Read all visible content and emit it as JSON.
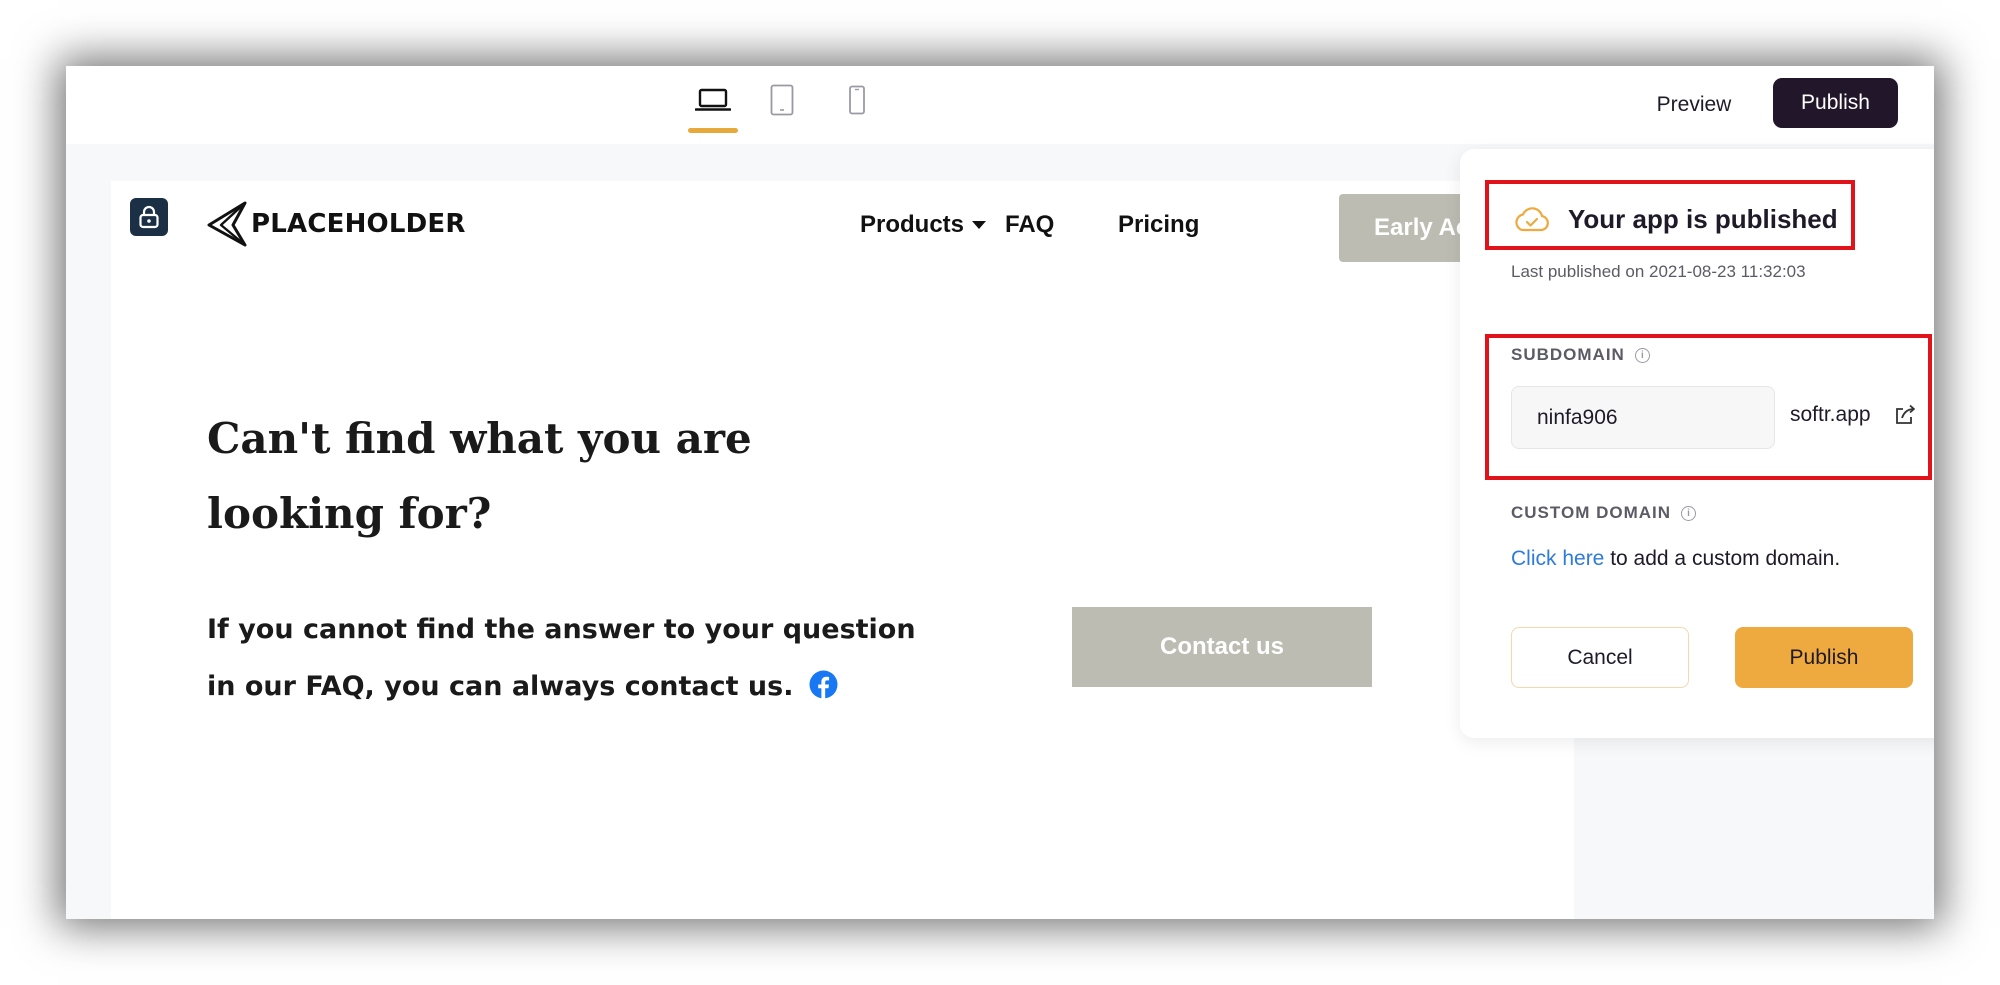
{
  "toolbar": {
    "devices": [
      {
        "icon": "laptop-icon",
        "active": true
      },
      {
        "icon": "tablet-icon",
        "active": false
      },
      {
        "icon": "mobile-icon",
        "active": false
      }
    ],
    "preview_label": "Preview",
    "publish_label": "Publish"
  },
  "site": {
    "logo_text": "PLACEHOLDER",
    "nav": {
      "products": "Products",
      "faq": "FAQ",
      "pricing": "Pricing",
      "cta": "Early Ac"
    },
    "heading": "Can't find what you are looking for?",
    "subtext": "If you cannot find the answer to your question in our FAQ, you can always contact us.",
    "contact_label": "Contact us"
  },
  "publish_popover": {
    "title": "Your app is published",
    "last_published": "Last published on 2021-08-23 11:32:03",
    "subdomain_label": "SUBDOMAIN",
    "subdomain_value": "ninfa906",
    "subdomain_suffix": "softr.app",
    "custom_domain_label": "CUSTOM DOMAIN",
    "custom_domain_link": "Click here",
    "custom_domain_text": " to add a custom domain.",
    "cancel_label": "Cancel",
    "publish_label": "Publish"
  },
  "colors": {
    "accent": "#eeaa3f",
    "dark_button": "#22172a",
    "highlight": "#e0131a",
    "link": "#2e7bdc",
    "muted_button": "#bcbcb2"
  }
}
